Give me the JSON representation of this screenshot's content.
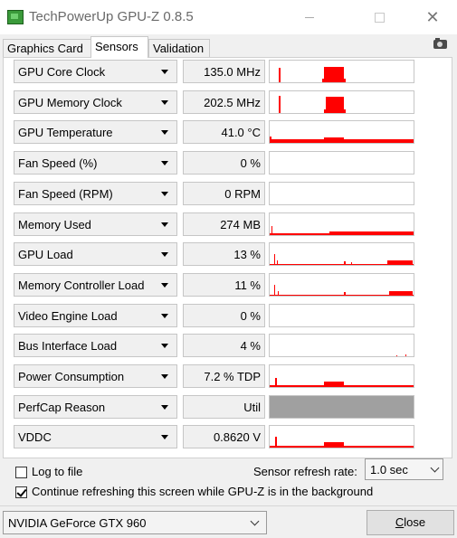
{
  "window": {
    "title": "TechPowerUp GPU-Z 0.8.5"
  },
  "tabs": [
    {
      "label": "Graphics Card",
      "active": false
    },
    {
      "label": "Sensors",
      "active": true
    },
    {
      "label": "Validation",
      "active": false
    }
  ],
  "colors": {
    "graph_line": "#ff0000",
    "graph_disabled": "#a0a0a0"
  },
  "sensors": [
    {
      "name": "GPU Core Clock",
      "value": "135.0 MHz",
      "graph": "core"
    },
    {
      "name": "GPU Memory Clock",
      "value": "202.5 MHz",
      "graph": "mem"
    },
    {
      "name": "GPU Temperature",
      "value": "41.0 °C",
      "graph": "temp"
    },
    {
      "name": "Fan Speed (%)",
      "value": "0 %",
      "graph": "none"
    },
    {
      "name": "Fan Speed (RPM)",
      "value": "0 RPM",
      "graph": "none"
    },
    {
      "name": "Memory Used",
      "value": "274 MB",
      "graph": "memused"
    },
    {
      "name": "GPU Load",
      "value": "13 %",
      "graph": "load"
    },
    {
      "name": "Memory Controller Load",
      "value": "11 %",
      "graph": "mcload"
    },
    {
      "name": "Video Engine Load",
      "value": "0 %",
      "graph": "none"
    },
    {
      "name": "Bus Interface Load",
      "value": "4 %",
      "graph": "bus"
    },
    {
      "name": "Power Consumption",
      "value": "7.2 % TDP",
      "graph": "power"
    },
    {
      "name": "PerfCap Reason",
      "value": "Util",
      "graph": "grey"
    },
    {
      "name": "VDDC",
      "value": "0.8620 V",
      "graph": "vddc"
    }
  ],
  "options": {
    "log_to_file": {
      "label": "Log to file",
      "checked": false
    },
    "continue_refresh": {
      "label": "Continue refreshing this screen while GPU-Z is in the background",
      "checked": true
    },
    "refresh_rate_label": "Sensor refresh rate:",
    "refresh_rate_value": "1.0 sec"
  },
  "footer": {
    "gpu_selected": "NVIDIA GeForce GTX 960",
    "close_label_underlined": "C",
    "close_label_rest": "lose"
  }
}
